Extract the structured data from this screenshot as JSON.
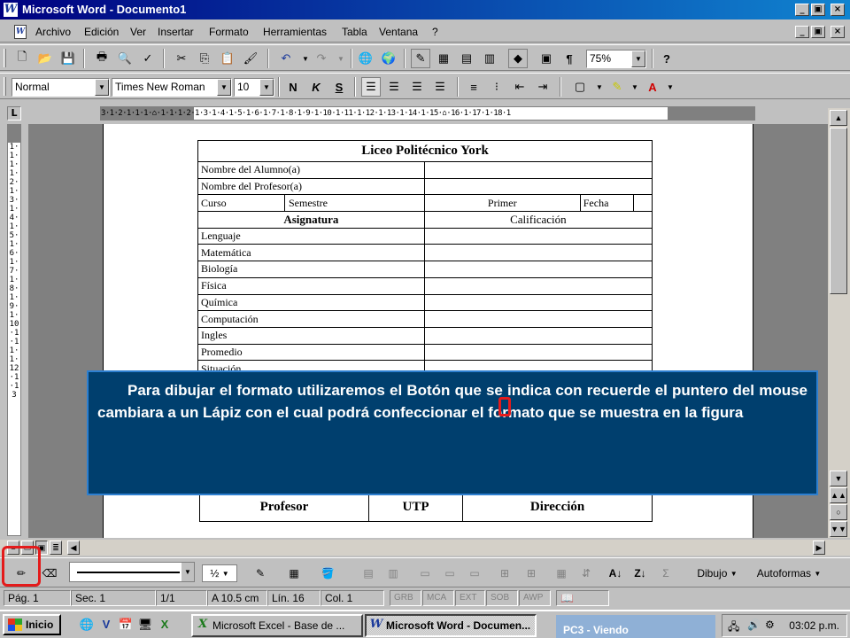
{
  "window": {
    "title": "Microsoft Word - Documento1",
    "app_icon": "W",
    "controls": [
      "_",
      "▣",
      "×"
    ]
  },
  "menu": {
    "items": [
      {
        "label": "Archivo"
      },
      {
        "label": "Edición"
      },
      {
        "label": "Ver"
      },
      {
        "label": "Insertar"
      },
      {
        "label": "Formato"
      },
      {
        "label": "Herramientas"
      },
      {
        "label": "Tabla"
      },
      {
        "label": "Ventana"
      },
      {
        "label": "?"
      }
    ]
  },
  "standard_toolbar": {
    "zoom": "75%",
    "icons": [
      "new-icon",
      "open-icon",
      "save-icon",
      "print-icon",
      "print-preview-icon",
      "spelling-icon",
      "cut-icon",
      "copy-icon",
      "paste-icon",
      "format-painter-icon",
      "undo-icon",
      "redo-icon",
      "hyperlink-icon",
      "web-icon",
      "tables-borders-icon",
      "insert-table-icon",
      "insert-excel-icon",
      "columns-icon",
      "drawing-icon",
      "document-map-icon",
      "show-hide-icon",
      "help-icon"
    ]
  },
  "format_toolbar": {
    "style": "Normal",
    "font": "Times New Roman",
    "size": "10",
    "bold": "N",
    "italic": "K",
    "underline": "S"
  },
  "ruler": {
    "h_marks": "3·1·2·1·1·1·⌂·1·1·1·2·1·3·1·4·1·5·1·6·1·7·1·8·1·9·1·10·1·11·1·12·1·13·1·14·1·15·⌂·16·1·17·1·18·1",
    "corner": "L",
    "v_marks": "1·1·1·1·2·1·3·1·4·1·5·1·6·1·7·1·8·1·9·1·10·1·11·1·12·1·13"
  },
  "document": {
    "school": "Liceo Politécnico York",
    "fields": {
      "student": "Nombre del Alumno(a)",
      "teacher": "Nombre del Profesor(a)",
      "course": "Curso",
      "semester": "Semestre",
      "semester_value": "Primer",
      "date": "Fecha"
    },
    "headers": {
      "subject": "Asignatura",
      "grade": "Calificación"
    },
    "subjects": [
      "Lenguaje",
      "Matemática",
      "Biología",
      "Física",
      "Química",
      "Computación",
      "Ingles",
      "Promedio",
      "Situación"
    ],
    "signatures": [
      "Profesor",
      "UTP",
      "Dirección"
    ]
  },
  "overlay": {
    "text": "Para dibujar el formato utilizaremos el Botón que se indica con recuerde el puntero del mouse cambiara a un Lápiz con el cual podrá confeccionar el formato que se muestra en la figura"
  },
  "draw_toolbar": {
    "line_weight": "½",
    "draw_menu": "Dibujo",
    "autoshapes": "Autoformas"
  },
  "status_bar": {
    "page": "Pág. 1",
    "section": "Sec. 1",
    "pages": "1/1",
    "position": "A  10.5 cm",
    "line": "Lín. 16",
    "column": "Col. 1",
    "modes": [
      "GRB",
      "MCA",
      "EXT",
      "SOB",
      "AWP"
    ]
  },
  "taskbar": {
    "start": "Inicio",
    "tasks": [
      {
        "label": "Microsoft Excel - Base de ...",
        "icon": "X"
      },
      {
        "label": "Microsoft Word - Documen...",
        "icon": "W"
      }
    ],
    "ghost": "PC3 - Viendo",
    "clock": "03:02 p.m."
  },
  "colors": {
    "overlay_bg": "#003f6e",
    "highlight": "#e41b1b",
    "title_bar": "#000080"
  }
}
